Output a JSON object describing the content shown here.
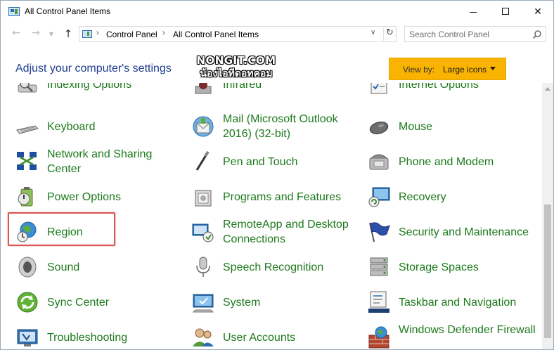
{
  "window": {
    "title": "All Control Panel Items"
  },
  "address": {
    "crumbs": [
      "Control Panel",
      "All Control Panel Items"
    ]
  },
  "search": {
    "placeholder": "Search Control Panel"
  },
  "content": {
    "heading": "Adjust your computer's settings",
    "view_by_label": "View by:",
    "view_by_value": "Large icons"
  },
  "watermark": {
    "line1": "NONGIT.COM",
    "line2": "น้องไอทีดอทคอม"
  },
  "items": {
    "col1": [
      {
        "label": "Indexing Options",
        "icon": "indexing-options-icon"
      },
      {
        "label": "Keyboard",
        "icon": "keyboard-icon"
      },
      {
        "label": "Network and Sharing Center",
        "icon": "network-sharing-icon"
      },
      {
        "label": "Power Options",
        "icon": "power-options-icon"
      },
      {
        "label": "Region",
        "icon": "region-icon"
      },
      {
        "label": "Sound",
        "icon": "sound-icon"
      },
      {
        "label": "Sync Center",
        "icon": "sync-center-icon"
      },
      {
        "label": "Troubleshooting",
        "icon": "troubleshooting-icon"
      }
    ],
    "col2": [
      {
        "label": "Infrared",
        "icon": "infrared-icon"
      },
      {
        "label": "Mail (Microsoft Outlook 2016) (32-bit)",
        "icon": "mail-icon"
      },
      {
        "label": "Pen and Touch",
        "icon": "pen-touch-icon"
      },
      {
        "label": "Programs and Features",
        "icon": "programs-features-icon"
      },
      {
        "label": "RemoteApp and Desktop Connections",
        "icon": "remoteapp-icon"
      },
      {
        "label": "Speech Recognition",
        "icon": "microphone-icon"
      },
      {
        "label": "System",
        "icon": "system-icon"
      },
      {
        "label": "User Accounts",
        "icon": "user-accounts-icon"
      }
    ],
    "col3": [
      {
        "label": "Internet Options",
        "icon": "internet-options-icon"
      },
      {
        "label": "Mouse",
        "icon": "mouse-icon"
      },
      {
        "label": "Phone and Modem",
        "icon": "phone-modem-icon"
      },
      {
        "label": "Recovery",
        "icon": "recovery-icon"
      },
      {
        "label": "Security and Maintenance",
        "icon": "security-flag-icon"
      },
      {
        "label": "Storage Spaces",
        "icon": "storage-spaces-icon"
      },
      {
        "label": "Taskbar and Navigation",
        "icon": "taskbar-icon"
      },
      {
        "label": "Windows Defender Firewall",
        "icon": "firewall-icon"
      }
    ]
  },
  "colors": {
    "link_green": "#1d7a1d",
    "heading_blue": "#1e3d8f",
    "highlight_red": "#d9534f",
    "viewby_bg": "#f9b300"
  }
}
